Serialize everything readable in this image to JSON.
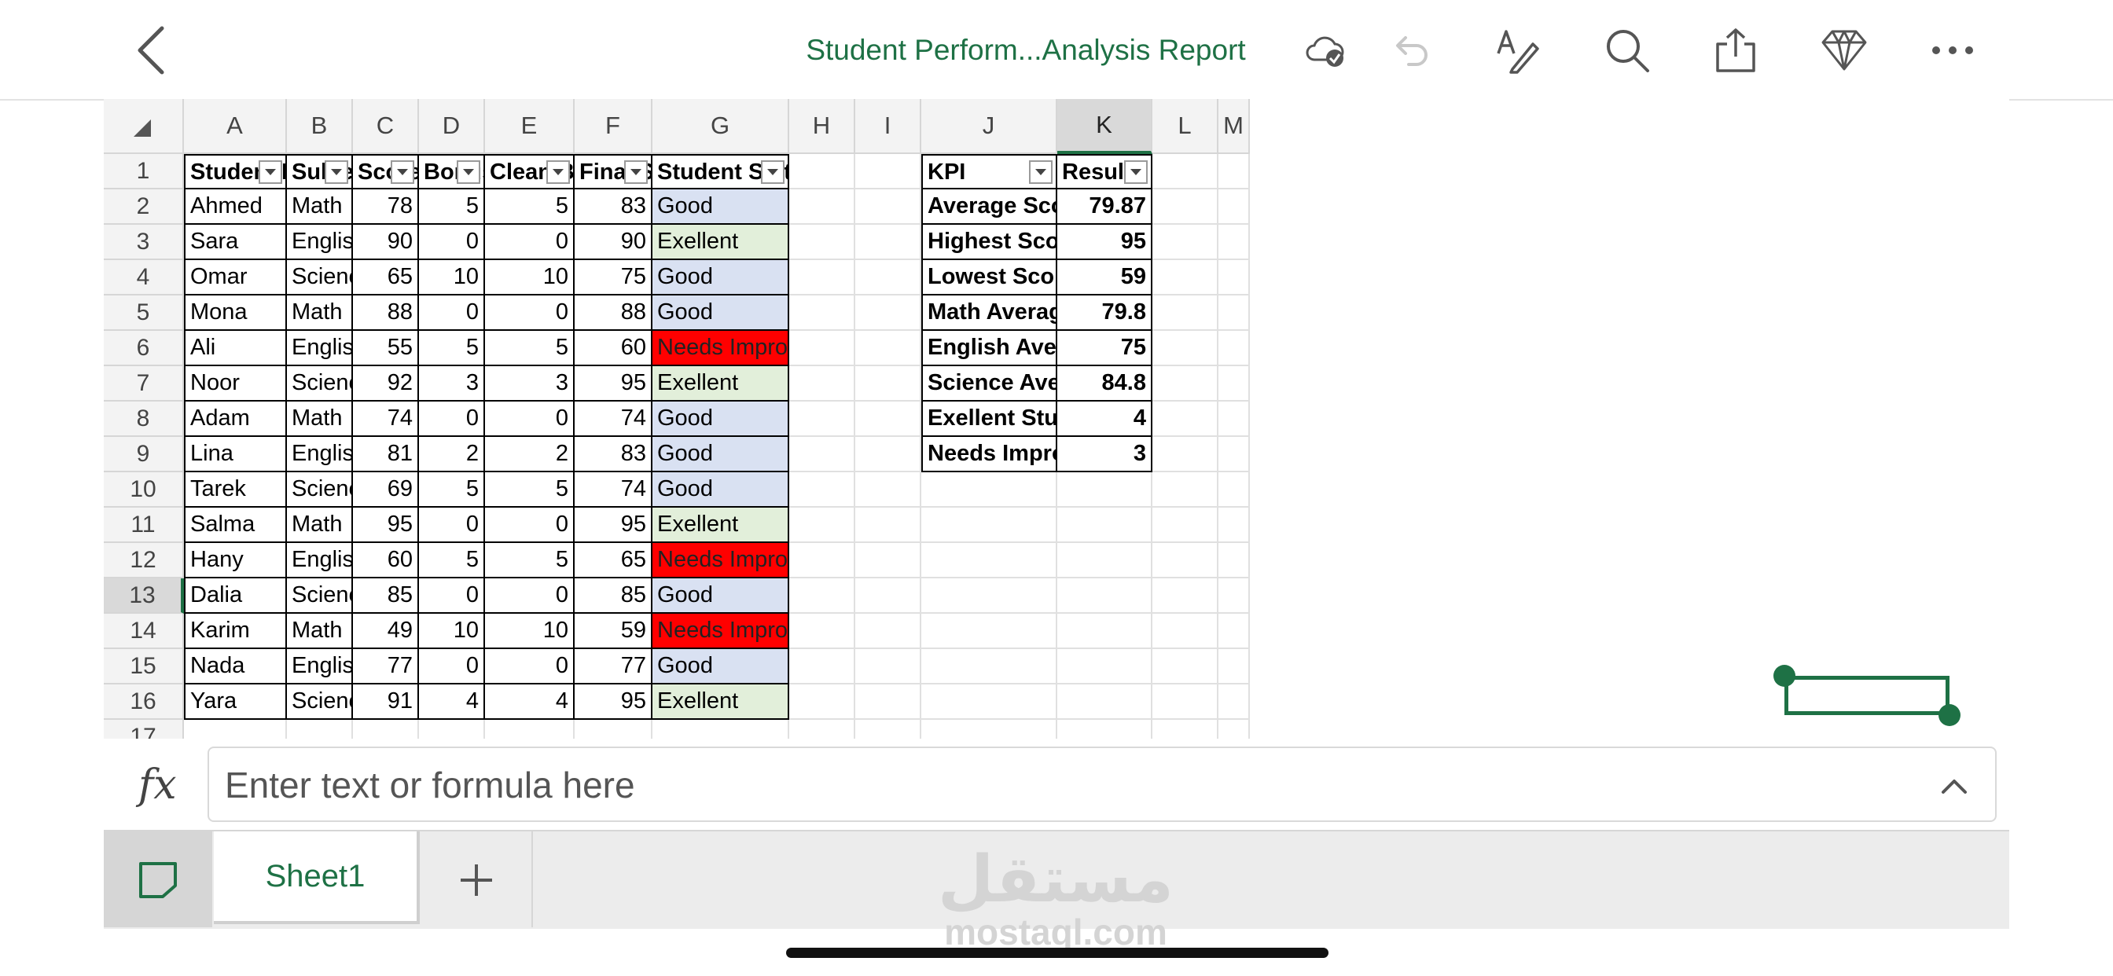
{
  "app": {
    "doc_title": "Student Perform...Analysis Report",
    "icons": [
      "back-icon",
      "cloud-saved-icon",
      "undo-icon",
      "draw-icon",
      "search-icon",
      "share-icon",
      "premium-diamond-icon",
      "more-icon"
    ]
  },
  "columns": [
    "A",
    "B",
    "C",
    "D",
    "E",
    "F",
    "G",
    "H",
    "I",
    "J",
    "K",
    "L",
    "M"
  ],
  "rows": [
    "1",
    "2",
    "3",
    "4",
    "5",
    "6",
    "7",
    "8",
    "9",
    "10",
    "11",
    "12",
    "13",
    "14",
    "15",
    "16",
    "17"
  ],
  "selected_column": "K",
  "selected_row": "13",
  "table": {
    "headers": [
      "Student Nam",
      "Subject",
      "Score",
      "Bonus",
      "Clean Bonu",
      "Final Scor",
      "Student Status"
    ],
    "rows": [
      {
        "name": "Ahmed",
        "subject": "Math",
        "score": "78",
        "bonus": "5",
        "clean_bonus": "5",
        "final": "83",
        "status": "Good",
        "status_type": "good"
      },
      {
        "name": "Sara",
        "subject": "English",
        "score": "90",
        "bonus": "0",
        "clean_bonus": "0",
        "final": "90",
        "status": "Exellent",
        "status_type": "exc"
      },
      {
        "name": "Omar",
        "subject": "Science",
        "score": "65",
        "bonus": "10",
        "clean_bonus": "10",
        "final": "75",
        "status": "Good",
        "status_type": "good"
      },
      {
        "name": "Mona",
        "subject": "Math",
        "score": "88",
        "bonus": "0",
        "clean_bonus": "0",
        "final": "88",
        "status": "Good",
        "status_type": "good"
      },
      {
        "name": "Ali",
        "subject": "English",
        "score": "55",
        "bonus": "5",
        "clean_bonus": "5",
        "final": "60",
        "status": "Needs Improvment",
        "status_type": "need"
      },
      {
        "name": "Noor",
        "subject": "Science",
        "score": "92",
        "bonus": "3",
        "clean_bonus": "3",
        "final": "95",
        "status": "Exellent",
        "status_type": "exc"
      },
      {
        "name": "Adam",
        "subject": "Math",
        "score": "74",
        "bonus": "0",
        "clean_bonus": "0",
        "final": "74",
        "status": "Good",
        "status_type": "good"
      },
      {
        "name": "Lina",
        "subject": "English",
        "score": "81",
        "bonus": "2",
        "clean_bonus": "2",
        "final": "83",
        "status": "Good",
        "status_type": "good"
      },
      {
        "name": "Tarek",
        "subject": "Science",
        "score": "69",
        "bonus": "5",
        "clean_bonus": "5",
        "final": "74",
        "status": "Good",
        "status_type": "good"
      },
      {
        "name": "Salma",
        "subject": "Math",
        "score": "95",
        "bonus": "0",
        "clean_bonus": "0",
        "final": "95",
        "status": "Exellent",
        "status_type": "exc"
      },
      {
        "name": "Hany",
        "subject": "English",
        "score": "60",
        "bonus": "5",
        "clean_bonus": "5",
        "final": "65",
        "status": "Needs Improvment",
        "status_type": "need"
      },
      {
        "name": "Dalia",
        "subject": "Science",
        "score": "85",
        "bonus": "0",
        "clean_bonus": "0",
        "final": "85",
        "status": "Good",
        "status_type": "good"
      },
      {
        "name": "Karim",
        "subject": "Math",
        "score": "49",
        "bonus": "10",
        "clean_bonus": "10",
        "final": "59",
        "status": "Needs Improvment",
        "status_type": "need"
      },
      {
        "name": "Nada",
        "subject": "English",
        "score": "77",
        "bonus": "0",
        "clean_bonus": "0",
        "final": "77",
        "status": "Good",
        "status_type": "good"
      },
      {
        "name": "Yara",
        "subject": "Science",
        "score": "91",
        "bonus": "4",
        "clean_bonus": "4",
        "final": "95",
        "status": "Exellent",
        "status_type": "exc"
      }
    ]
  },
  "kpi": {
    "headers": [
      "KPI",
      "Result"
    ],
    "rows": [
      {
        "label": "Average Score",
        "value": "79.87"
      },
      {
        "label": "Highest Score",
        "value": "95"
      },
      {
        "label": "Lowest Score",
        "value": "59"
      },
      {
        "label": "Math Average",
        "value": "79.8"
      },
      {
        "label": "English Average",
        "value": "75"
      },
      {
        "label": "Science Average",
        "value": "84.8"
      },
      {
        "label": "Exellent Students",
        "value": "4"
      },
      {
        "label": "Needs Improvment",
        "value": "3"
      }
    ]
  },
  "status_colors": {
    "good": "#d9e1f2",
    "exc": "#e2efda",
    "need": "#ff0000"
  },
  "formula_bar": {
    "fx_label": "fx",
    "placeholder": "Enter text or formula here"
  },
  "sheets": {
    "active": "Sheet1",
    "add_icon": "plus-icon"
  },
  "watermark": {
    "arabic": "مستقل",
    "latin": "mostaql.com"
  },
  "accent_color": "#1e7145"
}
